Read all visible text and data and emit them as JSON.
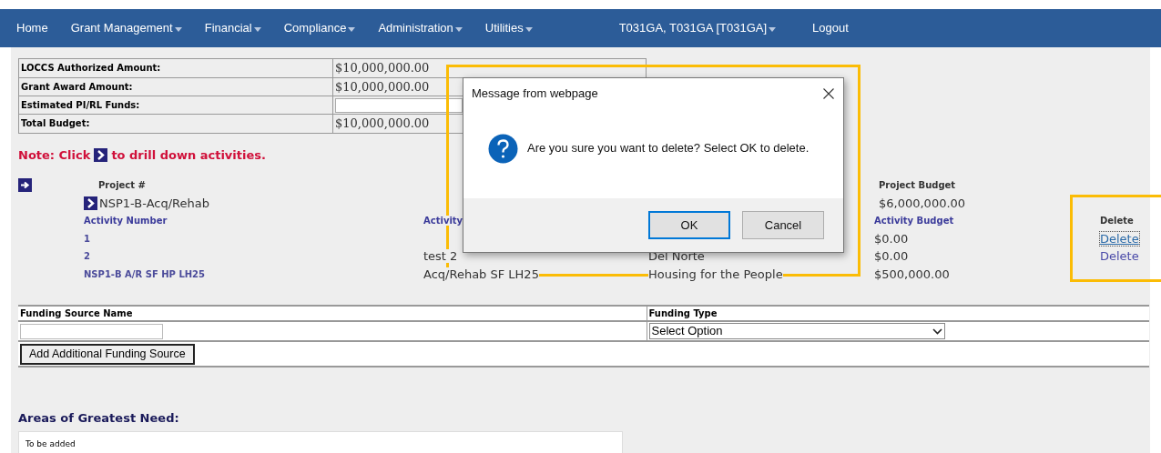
{
  "nav": [
    {
      "label": "Home",
      "dropdown": false
    },
    {
      "label": "Grant Management",
      "dropdown": true
    },
    {
      "label": "Financial",
      "dropdown": true
    },
    {
      "label": "Compliance",
      "dropdown": true
    },
    {
      "label": "Administration",
      "dropdown": true
    },
    {
      "label": "Utilities",
      "dropdown": true
    },
    {
      "label": "T031GA, T031GA [T031GA]",
      "dropdown": true
    },
    {
      "label": "Logout",
      "dropdown": false
    }
  ],
  "summary": [
    {
      "label": "LOCCS Authorized Amount:",
      "kind": "text",
      "value": "$10,000,000.00"
    },
    {
      "label": "Grant Award Amount:",
      "kind": "text",
      "value": "$10,000,000.00"
    },
    {
      "label": "Estimated PI/RL Funds:",
      "kind": "input"
    },
    {
      "label": "Total Budget:",
      "kind": "text",
      "value": "$10,000,000.00"
    }
  ],
  "note": {
    "before": "Note: Click",
    "after": "to drill down activities."
  },
  "project": {
    "header": "Project #",
    "name": "NSP1-B-Acq/Rehab",
    "budget_header": "Project Budget",
    "budget": "$6,000,000.00"
  },
  "activities": {
    "columns": [
      "Activity Number",
      "Activity",
      "Activity Budget",
      "Delete"
    ],
    "rows": [
      {
        "number": "1",
        "budget": "$0.00",
        "delete": "Delete",
        "focused": true
      },
      {
        "number": "2",
        "title": "test 2",
        "column_3": "Del Norte",
        "budget": "$0.00",
        "delete": "Delete",
        "focused": false
      },
      {
        "number": "NSP1-B A/R SF HP LH25",
        "title": "Acq/Rehab SF LH25",
        "column_3": "Housing for the People",
        "budget": "$500,000.00"
      }
    ]
  },
  "funding": {
    "columns": [
      "Funding Source Name",
      "Funding Type"
    ],
    "select": "Select Option",
    "button": "Add Additional Funding Source"
  },
  "areas": {
    "title": "Areas of Greatest Need:",
    "text": "To be added"
  },
  "dialog": {
    "title": "Message from webpage",
    "message": "Are you sure you want to delete? Select OK to delete.",
    "buttons": [
      {
        "label": "OK",
        "default": true
      },
      {
        "label": "Cancel",
        "default": false
      }
    ]
  }
}
